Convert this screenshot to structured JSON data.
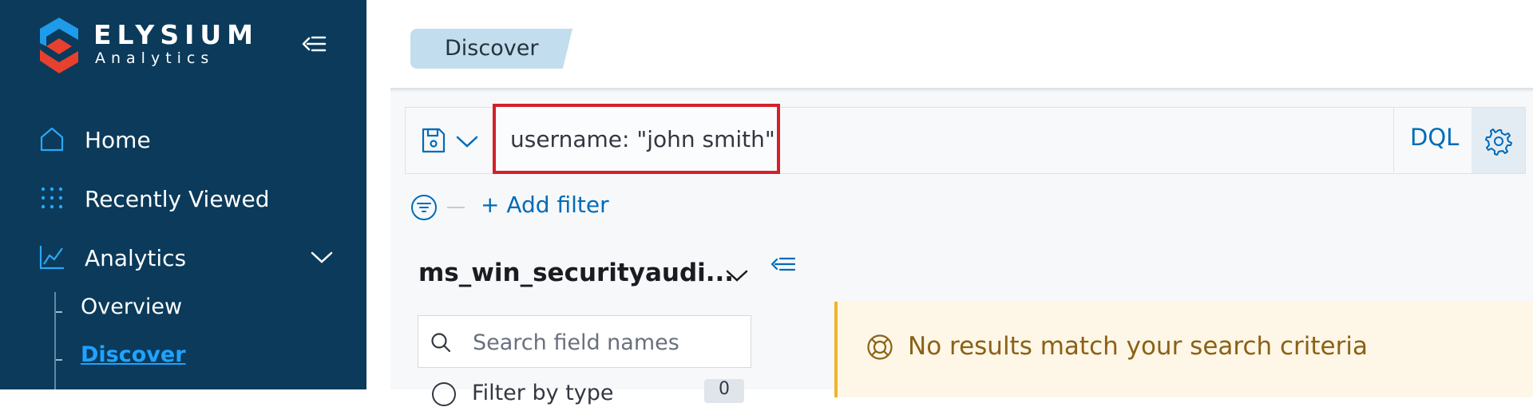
{
  "colors": {
    "sidebar_bg": "#0b3a5a",
    "accent": "#006bb8",
    "active_link": "#1fa3ff",
    "warning_text": "#8a6116",
    "highlight_border": "#d4202b"
  },
  "brand": {
    "name": "ELYSIUM",
    "subtitle": "Analytics",
    "logo_icon": "elysium-logo"
  },
  "sidebar": {
    "collapse_icon": "menu-collapse-icon",
    "items": [
      {
        "label": "Home",
        "icon": "home-icon"
      },
      {
        "label": "Recently Viewed",
        "icon": "grid-dots-icon"
      },
      {
        "label": "Analytics",
        "icon": "analytics-chart-icon",
        "expanded": true
      }
    ],
    "subitems": [
      {
        "label": "Overview",
        "active": false
      },
      {
        "label": "Discover",
        "active": true
      }
    ]
  },
  "header": {
    "breadcrumb": "Discover"
  },
  "query": {
    "value": "username: \"john smith\"",
    "language": "DQL",
    "save_icon": "save-icon",
    "settings_icon": "gear-icon"
  },
  "filters": {
    "add_label": "+ Add filter",
    "filter_icon": "filter-icon"
  },
  "index": {
    "name": "ms_win_securityaudi...",
    "field_search_placeholder": "Search field names",
    "filter_row_label": "Filter by type",
    "filter_count": "0"
  },
  "results": {
    "message": "No results match your search criteria",
    "icon": "lifebuoy-icon"
  }
}
